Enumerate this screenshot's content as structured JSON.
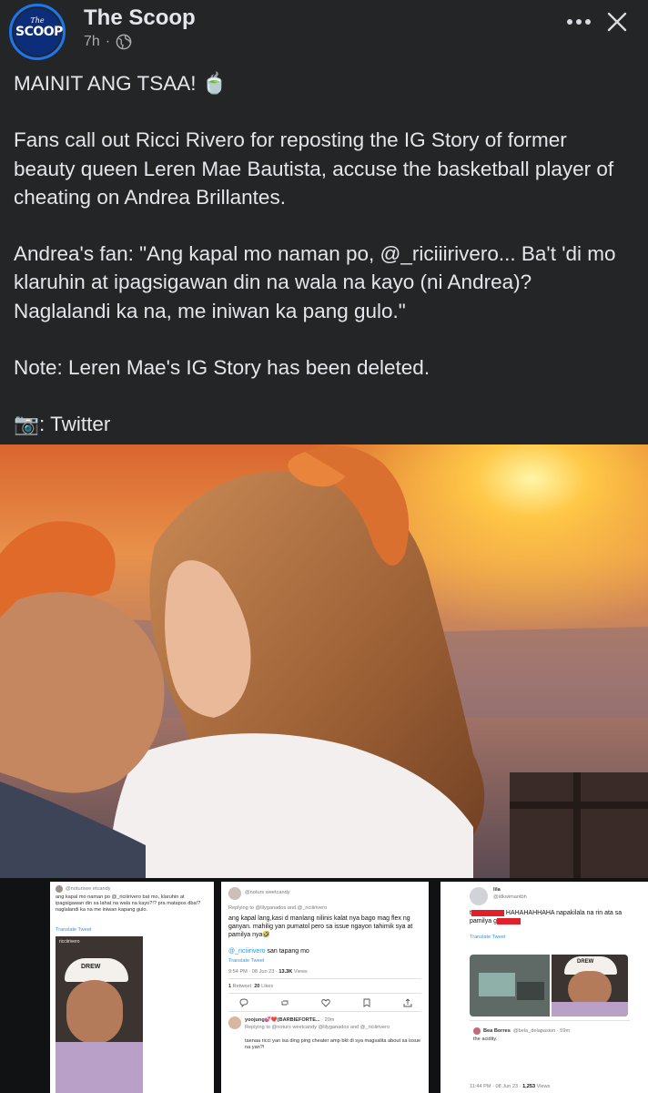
{
  "header": {
    "page_name": "The Scoop",
    "logo_top": "The",
    "logo_main": "SCOOP",
    "time": "7h",
    "separator": "·",
    "privacy_icon": "globe-icon",
    "more_icon": "more-horizontal-icon",
    "close_icon": "close-icon"
  },
  "post": {
    "line1": "MAINIT ANG TSAA! 🍵",
    "para2": "Fans call out Ricci Rivero for reposting the IG Story of former beauty queen Leren Mae Bautista, accuse the basketball player of cheating on Andrea Brillantes.",
    "para3": "Andrea's fan: \"Ang kapal mo naman po, @_riciiirivero... Ba't 'di mo klaruhin at ipagsigawan din na wala na kayo (ni Andrea)? Naglalandi ka na, me iniwan ka pang gulo.\"",
    "para4": "Note: Leren Mae's IG Story has been deleted.",
    "para5": "📷: Twitter"
  },
  "screenshot1": {
    "handle": "@noturswe etcandy",
    "text": "ang kapal mo naman po @_riciiirivero bat mo, klaruhin at ipagsigawan din sa lahat na wala na kayo?!? pra matapos dba!? naglalandi ka na me iniwan kapang gulo.",
    "translate": "Translate Tweet",
    "story_user": "ricciirivero",
    "cap_text": "DREW"
  },
  "screenshot2": {
    "handle": "@noturs weetcandy",
    "replying": "Replying to @lilyganados and @_riciiirivero",
    "body": "ang kapal lang,kasi d manlang nilinis kalat nya bago mag flex ng ganyan. mahilig yan pumatol pero sa issue ngayon tahimik sya at pamilya nya🤣",
    "mention": "@_riciiirivero",
    "mention_suffix": " san tapang mo",
    "translate": "Translate Tweet",
    "time": "9:54 PM · 08 Jun 23 ·",
    "views": "13.3K",
    "views_label": " Views",
    "retweets": "1",
    "retweets_label": " Retweet",
    "likes": "20",
    "likes_label": " Likes",
    "reply_name": "yoojung💕❤️(BARBIEFORTE...",
    "reply_age": "· 20m",
    "reply_to": "Replying to @noturs weetcandy @lilyganados and @_riciiirivero",
    "reply_body": "taenaa ricci yan isa ding ping cheater amp bkt di sya magsalita about sa issue na yan?!"
  },
  "screenshot3": {
    "name": "lila",
    "handle": "@idkwimantbh",
    "text_a": "t",
    "text_b": "HAHAHAHHAHA napakilala na rin ata sa pamilya g",
    "translate": "Translate Tweet",
    "cap_text": "DREW",
    "reply_name": "Bea Borres",
    "reply_handle": "@bela_delapasion · 59m",
    "reply_body": "the acidity.",
    "time": "11:44 PM · 08 Jun 23 ·",
    "views": "1,253",
    "views_label": " Views"
  },
  "colors": {
    "background": "#242526",
    "text": "#e4e6eb",
    "muted": "#a8abaf",
    "brand_blue": "#1877f2",
    "twitter_blue": "#1d9bf0",
    "redaction": "#e0202a"
  }
}
